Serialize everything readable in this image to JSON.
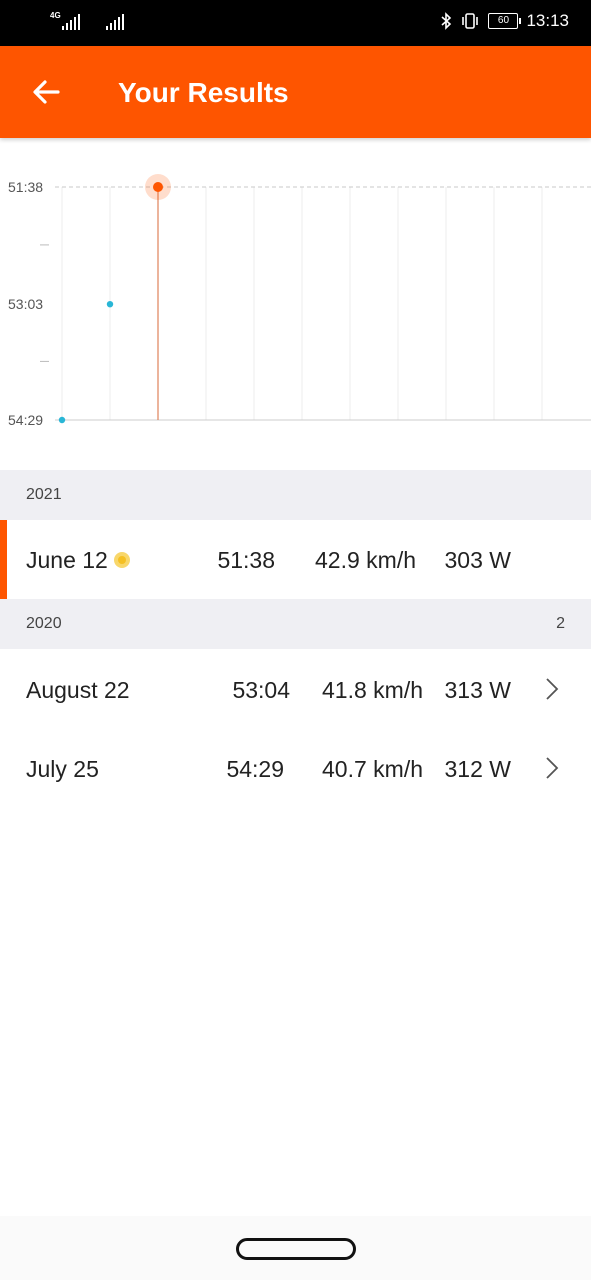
{
  "status_bar": {
    "network_label": "4G",
    "time": "13:13",
    "battery": "60"
  },
  "header": {
    "title": "Your Results"
  },
  "chart_data": {
    "type": "scatter",
    "y_tick_labels": [
      "51:38",
      "53:03",
      "54:29"
    ],
    "y_inverted": true,
    "points": [
      {
        "date": "July 25, 2020",
        "value": "54:29",
        "highlighted": false
      },
      {
        "date": "August 22, 2020",
        "value": "53:04",
        "highlighted": false
      },
      {
        "date": "June 12, 2021",
        "value": "51:38",
        "highlighted": true
      }
    ],
    "grid": true,
    "colors": {
      "point": "#29b6d6",
      "highlight": "#fe5500"
    }
  },
  "sections": [
    {
      "year": "2021",
      "count": "",
      "rows": [
        {
          "date": "June 12",
          "time": "51:38",
          "speed": "42.9 km/h",
          "power": "303 W",
          "current": true
        }
      ]
    },
    {
      "year": "2020",
      "count": "2",
      "rows": [
        {
          "date": "August 22",
          "time": "53:04",
          "speed": "41.8 km/h",
          "power": "313 W",
          "current": false
        },
        {
          "date": "July 25",
          "time": "54:29",
          "speed": "40.7 km/h",
          "power": "312 W",
          "current": false
        }
      ]
    }
  ],
  "colors": {
    "accent": "#fe5500",
    "section_bg": "#efeff3"
  }
}
